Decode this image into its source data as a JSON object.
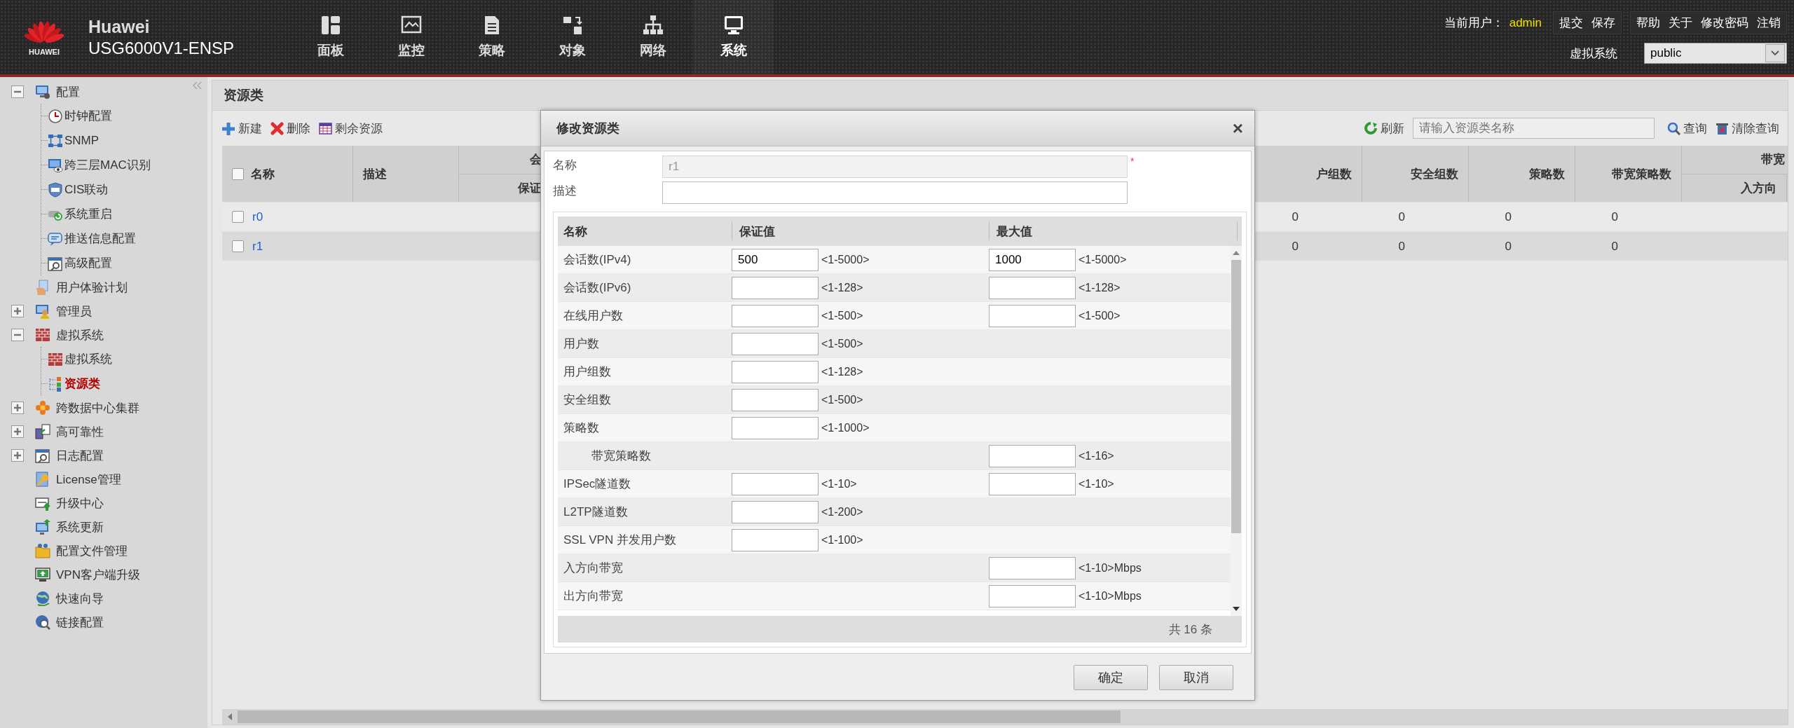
{
  "header": {
    "logo_text": "HUAWEI",
    "brand": "Huawei",
    "model": "USG6000V1-ENSP",
    "nav": [
      {
        "label": "面板",
        "selected": false
      },
      {
        "label": "监控",
        "selected": false
      },
      {
        "label": "策略",
        "selected": false
      },
      {
        "label": "对象",
        "selected": false
      },
      {
        "label": "网络",
        "selected": false
      },
      {
        "label": "系统",
        "selected": true
      }
    ],
    "user_label": "当前用户：",
    "user": "admin",
    "action_groups": [
      [
        "提交",
        "保存"
      ],
      [
        "帮助",
        "关于",
        "修改密码",
        "注销"
      ]
    ],
    "vsys_label": "虚拟系统",
    "vsys_value": "public"
  },
  "sidebar": {
    "items": [
      {
        "label": "配置",
        "kind": "group",
        "expanded": true,
        "selected": false,
        "children": [
          {
            "label": "时钟配置",
            "selected": false
          },
          {
            "label": "SNMP",
            "selected": false
          },
          {
            "label": "跨三层MAC识别",
            "selected": false
          },
          {
            "label": "CIS联动",
            "selected": false
          },
          {
            "label": "系统重启",
            "selected": false
          },
          {
            "label": "推送信息配置",
            "selected": false
          },
          {
            "label": "高级配置",
            "selected": false
          }
        ]
      },
      {
        "label": "用户体验计划",
        "kind": "leaf",
        "selected": false
      },
      {
        "label": "管理员",
        "kind": "group",
        "expanded": false,
        "selected": false
      },
      {
        "label": "虚拟系统",
        "kind": "group",
        "expanded": true,
        "selected": false,
        "children": [
          {
            "label": "虚拟系统",
            "selected": false
          },
          {
            "label": "资源类",
            "selected": true
          }
        ]
      },
      {
        "label": "跨数据中心集群",
        "kind": "group",
        "expanded": false,
        "selected": false
      },
      {
        "label": "高可靠性",
        "kind": "group",
        "expanded": false,
        "selected": false
      },
      {
        "label": "日志配置",
        "kind": "group",
        "expanded": false,
        "selected": false
      },
      {
        "label": "License管理",
        "kind": "leaf",
        "selected": false
      },
      {
        "label": "升级中心",
        "kind": "leaf",
        "selected": false
      },
      {
        "label": "系统更新",
        "kind": "leaf",
        "selected": false
      },
      {
        "label": "配置文件管理",
        "kind": "leaf",
        "selected": false
      },
      {
        "label": "VPN客户端升级",
        "kind": "leaf",
        "selected": false
      },
      {
        "label": "快速向导",
        "kind": "leaf",
        "selected": false
      },
      {
        "label": "链接配置",
        "kind": "leaf",
        "selected": false
      }
    ]
  },
  "panel": {
    "title": "资源类",
    "toolbar": [
      "新建",
      "删除",
      "剩余资源"
    ],
    "refresh": "刷新",
    "search": {
      "placeholder": "请输入资源类名称"
    },
    "query": "查询",
    "clear": "清除查询"
  },
  "table": {
    "select_all_checked": false,
    "left_columns": [
      "名称",
      "描述"
    ],
    "left_group": {
      "label": "会",
      "sub": "保证"
    },
    "right_columns": [
      "户组数",
      "安全组数",
      "策略数",
      "带宽策略数"
    ],
    "right_group": {
      "label": "带宽",
      "sub": "入方向"
    },
    "rows": [
      {
        "name": "r0",
        "checked": false,
        "values": [
          "0",
          "0",
          "0",
          "0"
        ]
      },
      {
        "name": "r1",
        "checked": false,
        "values": [
          "0",
          "0",
          "0",
          "0"
        ]
      }
    ]
  },
  "dialog": {
    "title": "修改资源类",
    "close": "×",
    "fields": [
      {
        "label": "名称",
        "value": "r1",
        "disabled": true,
        "required_mark": "*"
      },
      {
        "label": "描述",
        "disabled": false
      }
    ],
    "table": {
      "columns": [
        "名称",
        "保证值",
        "最大值"
      ],
      "rows": [
        {
          "name": "会话数(IPv4)",
          "indented": false,
          "guaranteed": {
            "value": "500",
            "range": "<1-5000>"
          },
          "maximum": {
            "value": "1000",
            "range": "<1-5000>"
          }
        },
        {
          "name": "会话数(IPv6)",
          "indented": false,
          "guaranteed": {
            "range": "<1-128>"
          },
          "maximum": {
            "range": "<1-128>"
          }
        },
        {
          "name": "在线用户数",
          "indented": false,
          "guaranteed": {
            "range": "<1-500>"
          },
          "maximum": {
            "range": "<1-500>"
          }
        },
        {
          "name": "用户数",
          "indented": false,
          "guaranteed": {
            "range": "<1-500>"
          }
        },
        {
          "name": "用户组数",
          "indented": false,
          "guaranteed": {
            "range": "<1-128>"
          }
        },
        {
          "name": "安全组数",
          "indented": false,
          "guaranteed": {
            "range": "<1-500>"
          }
        },
        {
          "name": "策略数",
          "indented": false,
          "guaranteed": {
            "range": "<1-1000>"
          }
        },
        {
          "name": "带宽策略数",
          "indented": true,
          "maximum": {
            "range": "<1-16>"
          }
        },
        {
          "name": "IPSec隧道数",
          "indented": false,
          "guaranteed": {
            "range": "<1-10>"
          },
          "maximum": {
            "range": "<1-10>"
          }
        },
        {
          "name": "L2TP隧道数",
          "indented": false,
          "guaranteed": {
            "range": "<1-200>"
          }
        },
        {
          "name": "SSL VPN 并发用户数",
          "indented": false,
          "guaranteed": {
            "range": "<1-100>"
          }
        },
        {
          "name": "入方向带宽",
          "indented": false,
          "maximum": {
            "range": "<1-10>Mbps"
          }
        },
        {
          "name": "出方向带宽",
          "indented": false,
          "maximum": {
            "range": "<1-10>Mbps"
          }
        }
      ],
      "footer": "共 16 条"
    },
    "buttons": [
      "确定",
      "取消"
    ]
  }
}
